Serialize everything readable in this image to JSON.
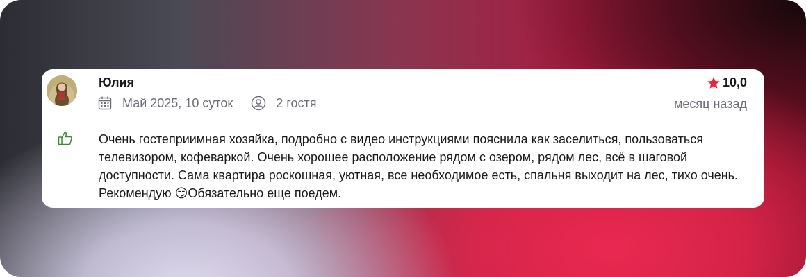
{
  "review": {
    "author": "Юлия",
    "stay": "Май 2025, 10 суток",
    "guests": "2 гостя",
    "rating": "10,0",
    "posted": "месяц назад",
    "text_before_emoji": "Очень гостеприимная хозяйка, подробно с видео инструкциями пояснила как заселиться, пользоваться телевизором, кофеваркой. Очень хорошее расположение рядом с озером, рядом лес, всё в шаговой доступности. Сама квартира роскошная, уютная, все необходимое есть, спальня выходит на лес, тихо очень. Рекомендую ",
    "emoji": "😏",
    "text_after_emoji": "Обязательно еще поедем."
  },
  "icons": {
    "calendar": "calendar-icon",
    "guests": "person-icon",
    "rating": "star-icon",
    "like": "thumbs-up-icon",
    "avatar": "avatar"
  },
  "colors": {
    "star": "#e8283f",
    "like": "#3f8a2e",
    "muted_text": "#6e6e78"
  }
}
